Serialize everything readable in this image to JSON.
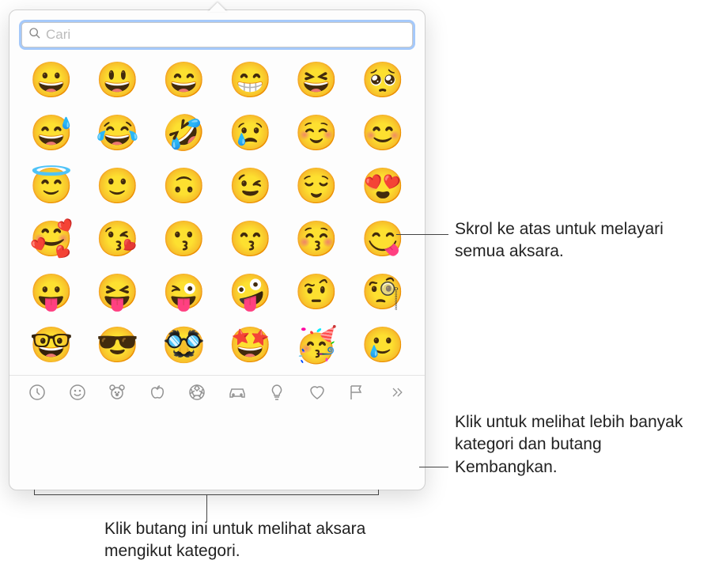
{
  "search": {
    "placeholder": "Cari",
    "value": ""
  },
  "emoji_grid": {
    "rows": [
      [
        "😀",
        "😃",
        "😄",
        "😁",
        "😆",
        "🥺"
      ],
      [
        "😅",
        "😂",
        "🤣",
        "😢",
        "☺️",
        "😊"
      ],
      [
        "😇",
        "🙂",
        "🙃",
        "😉",
        "😌",
        "😍"
      ],
      [
        "🥰",
        "😘",
        "😗",
        "😙",
        "😚",
        "😋"
      ],
      [
        "😛",
        "😝",
        "😜",
        "🤪",
        "🤨",
        "🧐"
      ],
      [
        "🤓",
        "😎",
        "🥸",
        "🤩",
        "🥳",
        "🥲"
      ]
    ]
  },
  "categories": [
    {
      "name": "recent"
    },
    {
      "name": "smileys"
    },
    {
      "name": "animals"
    },
    {
      "name": "food"
    },
    {
      "name": "activity"
    },
    {
      "name": "travel"
    },
    {
      "name": "objects"
    },
    {
      "name": "symbols"
    },
    {
      "name": "flags"
    },
    {
      "name": "expand"
    }
  ],
  "callouts": {
    "scroll": "Skrol ke atas untuk melayari semua aksara.",
    "expand": "Klik untuk melihat lebih banyak kategori dan butang Kembangkan.",
    "categories": "Klik butang ini untuk melihat aksara mengikut kategori."
  }
}
